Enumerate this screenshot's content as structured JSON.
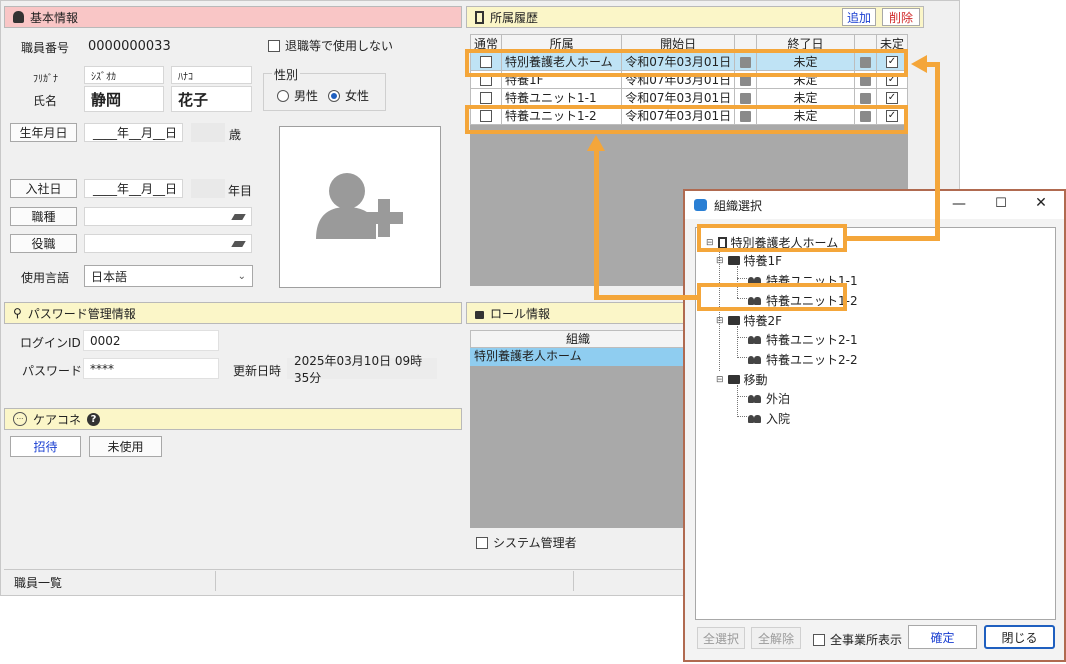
{
  "basic": {
    "title": "基本情報",
    "staff_no_label": "職員番号",
    "staff_no": "0000000033",
    "retired_label": "退職等で使用しない",
    "furigana_label": "ﾌﾘｶﾞﾅ",
    "furi_last": "ｼｽﾞｵｶ",
    "furi_first": "ﾊﾅｺ",
    "name_label": "氏名",
    "last_name": "静岡",
    "first_name": "花子",
    "gender_label": "性別",
    "male": "男性",
    "female": "女性",
    "birth_button": "生年月日",
    "birth_placeholder": "____年__月__日",
    "age_unit": "歳",
    "hire_button": "入社日",
    "hire_placeholder": "____年__月__日",
    "years_unit": "年目",
    "job_button": "職種",
    "position_button": "役職",
    "language_label": "使用言語",
    "language_value": "日本語"
  },
  "affiliation": {
    "title": "所属履歴",
    "add_label": "追加",
    "delete_label": "削除",
    "columns": [
      "通常",
      "所属",
      "開始日",
      "終了日",
      "未定"
    ],
    "rows": [
      {
        "name": "特別養護老人ホーム",
        "start": "令和07年03月01日",
        "end": "未定"
      },
      {
        "name": "特養1F",
        "start": "令和07年03月01日",
        "end": "未定"
      },
      {
        "name": "特養ユニット1-1",
        "start": "令和07年03月01日",
        "end": "未定"
      },
      {
        "name": "特養ユニット1-2",
        "start": "令和07年03月01日",
        "end": "未定"
      }
    ]
  },
  "password": {
    "title": "パスワード管理情報",
    "login_label": "ログインID",
    "login_value": "0002",
    "password_label": "パスワード",
    "password_value": "****",
    "updated_label": "更新日時",
    "updated_value": "2025年03月10日 09時35分"
  },
  "role": {
    "title": "ロール情報",
    "column": "組織",
    "row": "特別養護老人ホーム",
    "system_admin_label": "システム管理者"
  },
  "careconne": {
    "title": "ケアコネ",
    "invite_label": "招待",
    "unused_label": "未使用"
  },
  "statusbar": {
    "left": "職員一覧"
  },
  "dialog": {
    "title": "組織選択",
    "tree": {
      "root": "特別養護老人ホーム",
      "f1": "特養1F",
      "u11": "特養ユニット1-1",
      "u12": "特養ユニット1-2",
      "f2": "特養2F",
      "u21": "特養ユニット2-1",
      "u22": "特養ユニット2-2",
      "move": "移動",
      "out": "外泊",
      "hosp": "入院"
    },
    "select_all": "全選択",
    "deselect_all": "全解除",
    "show_all_label": "全事業所表示",
    "confirm": "確定",
    "close": "閉じる"
  },
  "colors": {
    "highlight": "#f4a63a",
    "selected_row": "#bfe3f5",
    "link_blue": "#1a3fd1"
  }
}
